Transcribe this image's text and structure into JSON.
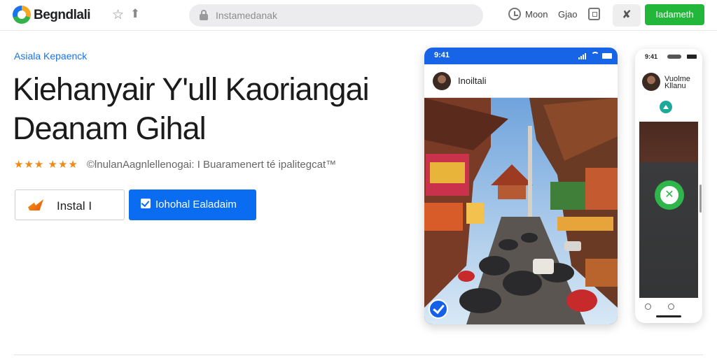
{
  "topbar": {
    "brand": "Begndlali",
    "search_placeholder": "Instamedanak",
    "nav_item_1": "Moon",
    "nav_item_2": "Gjao",
    "share_icon": "✘",
    "primary_button": "Iadameth"
  },
  "hero": {
    "eyebrow": "Asiala Kepaenck",
    "headline": "Kiehanyair Y'ull Kaoriangai Deanam Gihal",
    "stars": "★★★ ★★★",
    "rating_text": "©lnulanAagnlellenogai: I Buaramenert té ipalitegcat™",
    "install_label": "Instal I",
    "secondary_label": "Iohohal Ealadaim"
  },
  "phone_main": {
    "time": "9:41",
    "profile_name": "Inoiltali"
  },
  "phone_side": {
    "time": "9:41",
    "profile_name": "Vuolme Kllanu"
  },
  "colors": {
    "accent_blue": "#0a6cf0",
    "accent_green": "#22b73a",
    "star_orange": "#f08a12"
  }
}
